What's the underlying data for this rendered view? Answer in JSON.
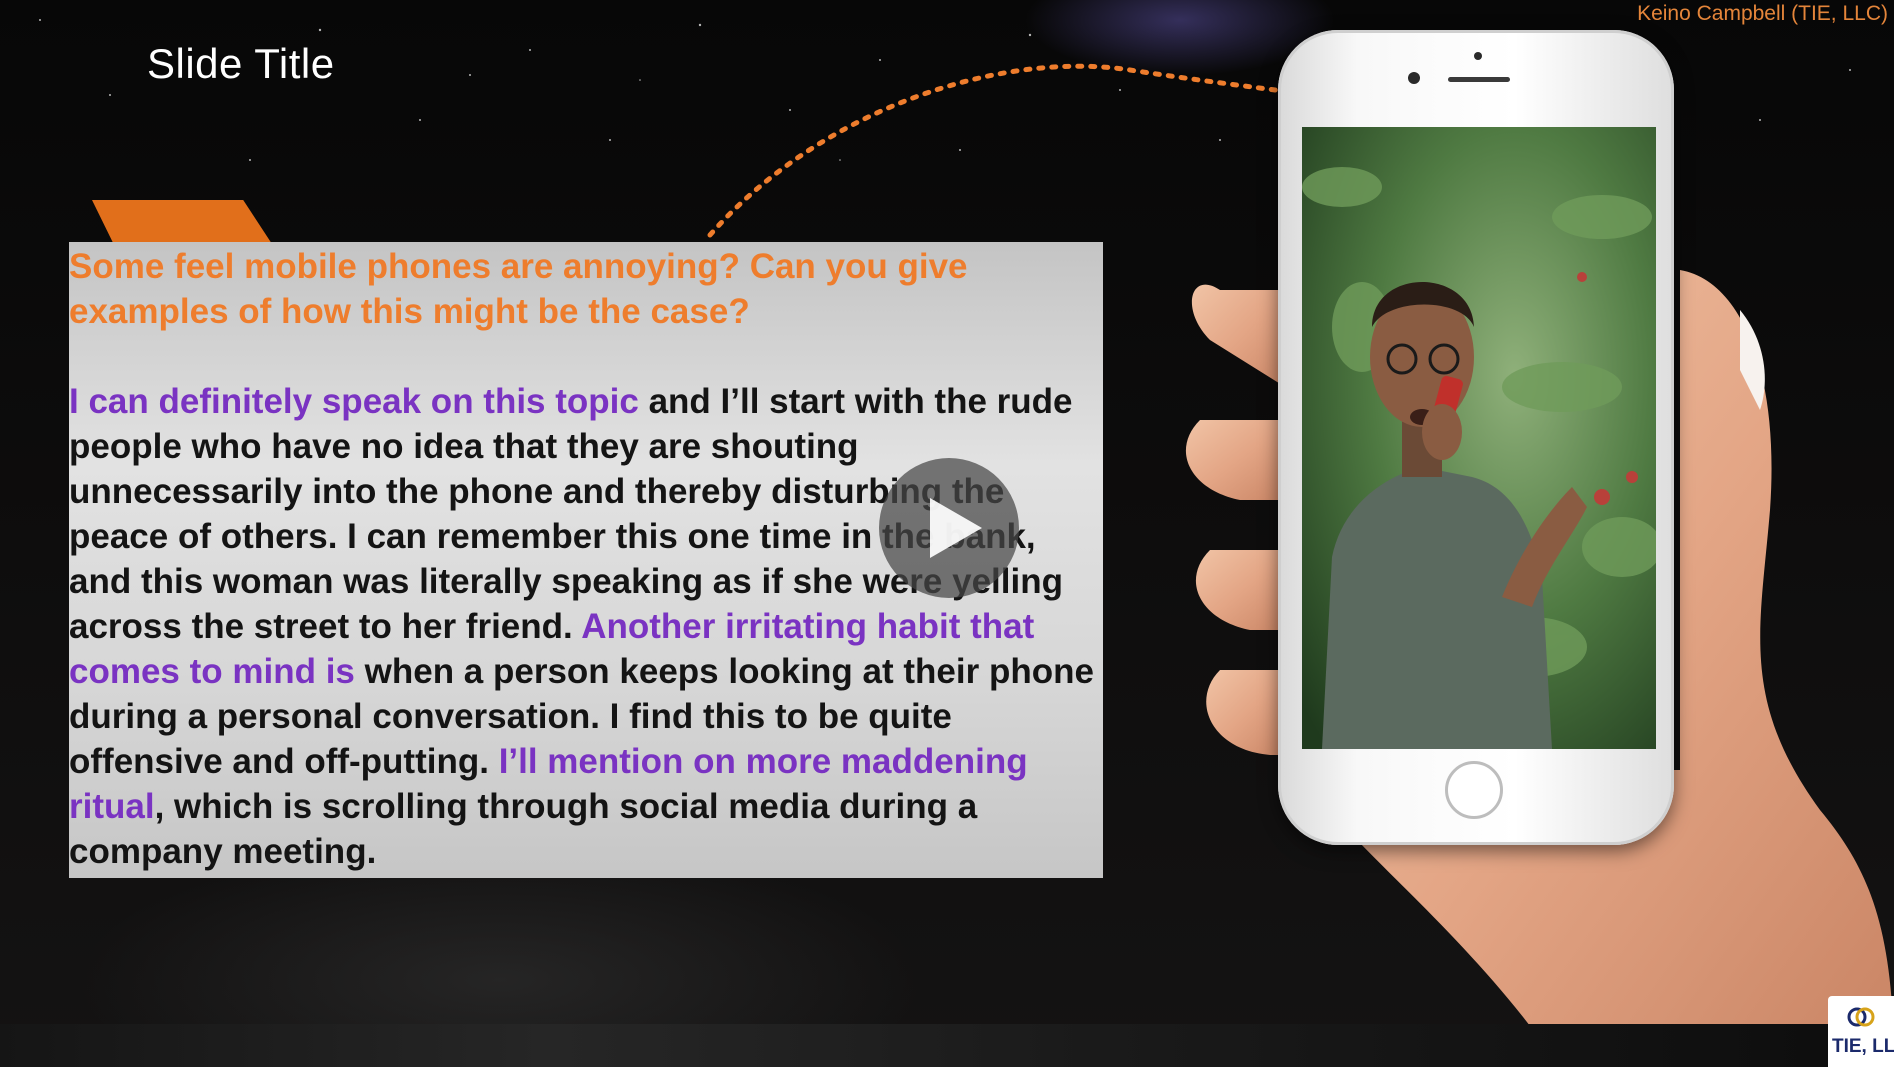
{
  "slide": {
    "title": "Slide Title",
    "presenter": "Keino Campbell (TIE, LLC)"
  },
  "panel": {
    "question": "Some feel mobile phones are annoying? Can you give examples of how this might be the case?",
    "answer": [
      {
        "text": "I can definitely speak on this topic",
        "highlight": true
      },
      {
        "text": " and I’ll start with the rude people who have no idea that they are shouting unnecessarily into the phone and thereby disturbing the peace of others. I can remember this one time in the bank, and this woman was literally speaking as if she were yelling across the street to her friend.  ",
        "highlight": false
      },
      {
        "text": "Another irritating habit that comes to mind is",
        "highlight": true
      },
      {
        "text": " when a person keeps looking at their phone during a personal conversation. I find this to be quite offensive and off-putting. ",
        "highlight": false
      },
      {
        "text": "I’ll mention on more maddening ritual",
        "highlight": true
      },
      {
        "text": ", which is scrolling through social media during a company meeting.",
        "highlight": false
      }
    ]
  },
  "logo": {
    "text": "TIE, LLC"
  },
  "colors": {
    "accent_orange": "#ee7d2d",
    "highlight_purple": "#7a33c2",
    "body_text": "#141414"
  },
  "icons": {
    "play": "play-icon"
  }
}
